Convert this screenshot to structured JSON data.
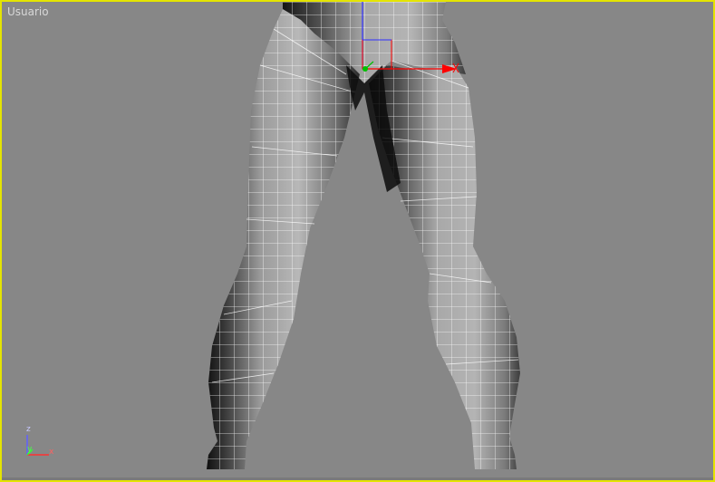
{
  "viewport": {
    "label": "Usuario",
    "border_color": "#e4e400",
    "background_color": "#878787"
  },
  "axis_tripod": {
    "x_label": "x",
    "y_label": "y",
    "z_label": "z",
    "x_color": "#ff3030",
    "y_color": "#30ff30",
    "z_color": "#6060ff"
  },
  "gizmo": {
    "icon": "transform-gizmo-icon",
    "x_color": "#ff0000",
    "y_color": "#00c000",
    "z_color": "#3030ff"
  },
  "model": {
    "icon": "mesh-wireframe-icon",
    "wire_color": "#ffffff"
  }
}
